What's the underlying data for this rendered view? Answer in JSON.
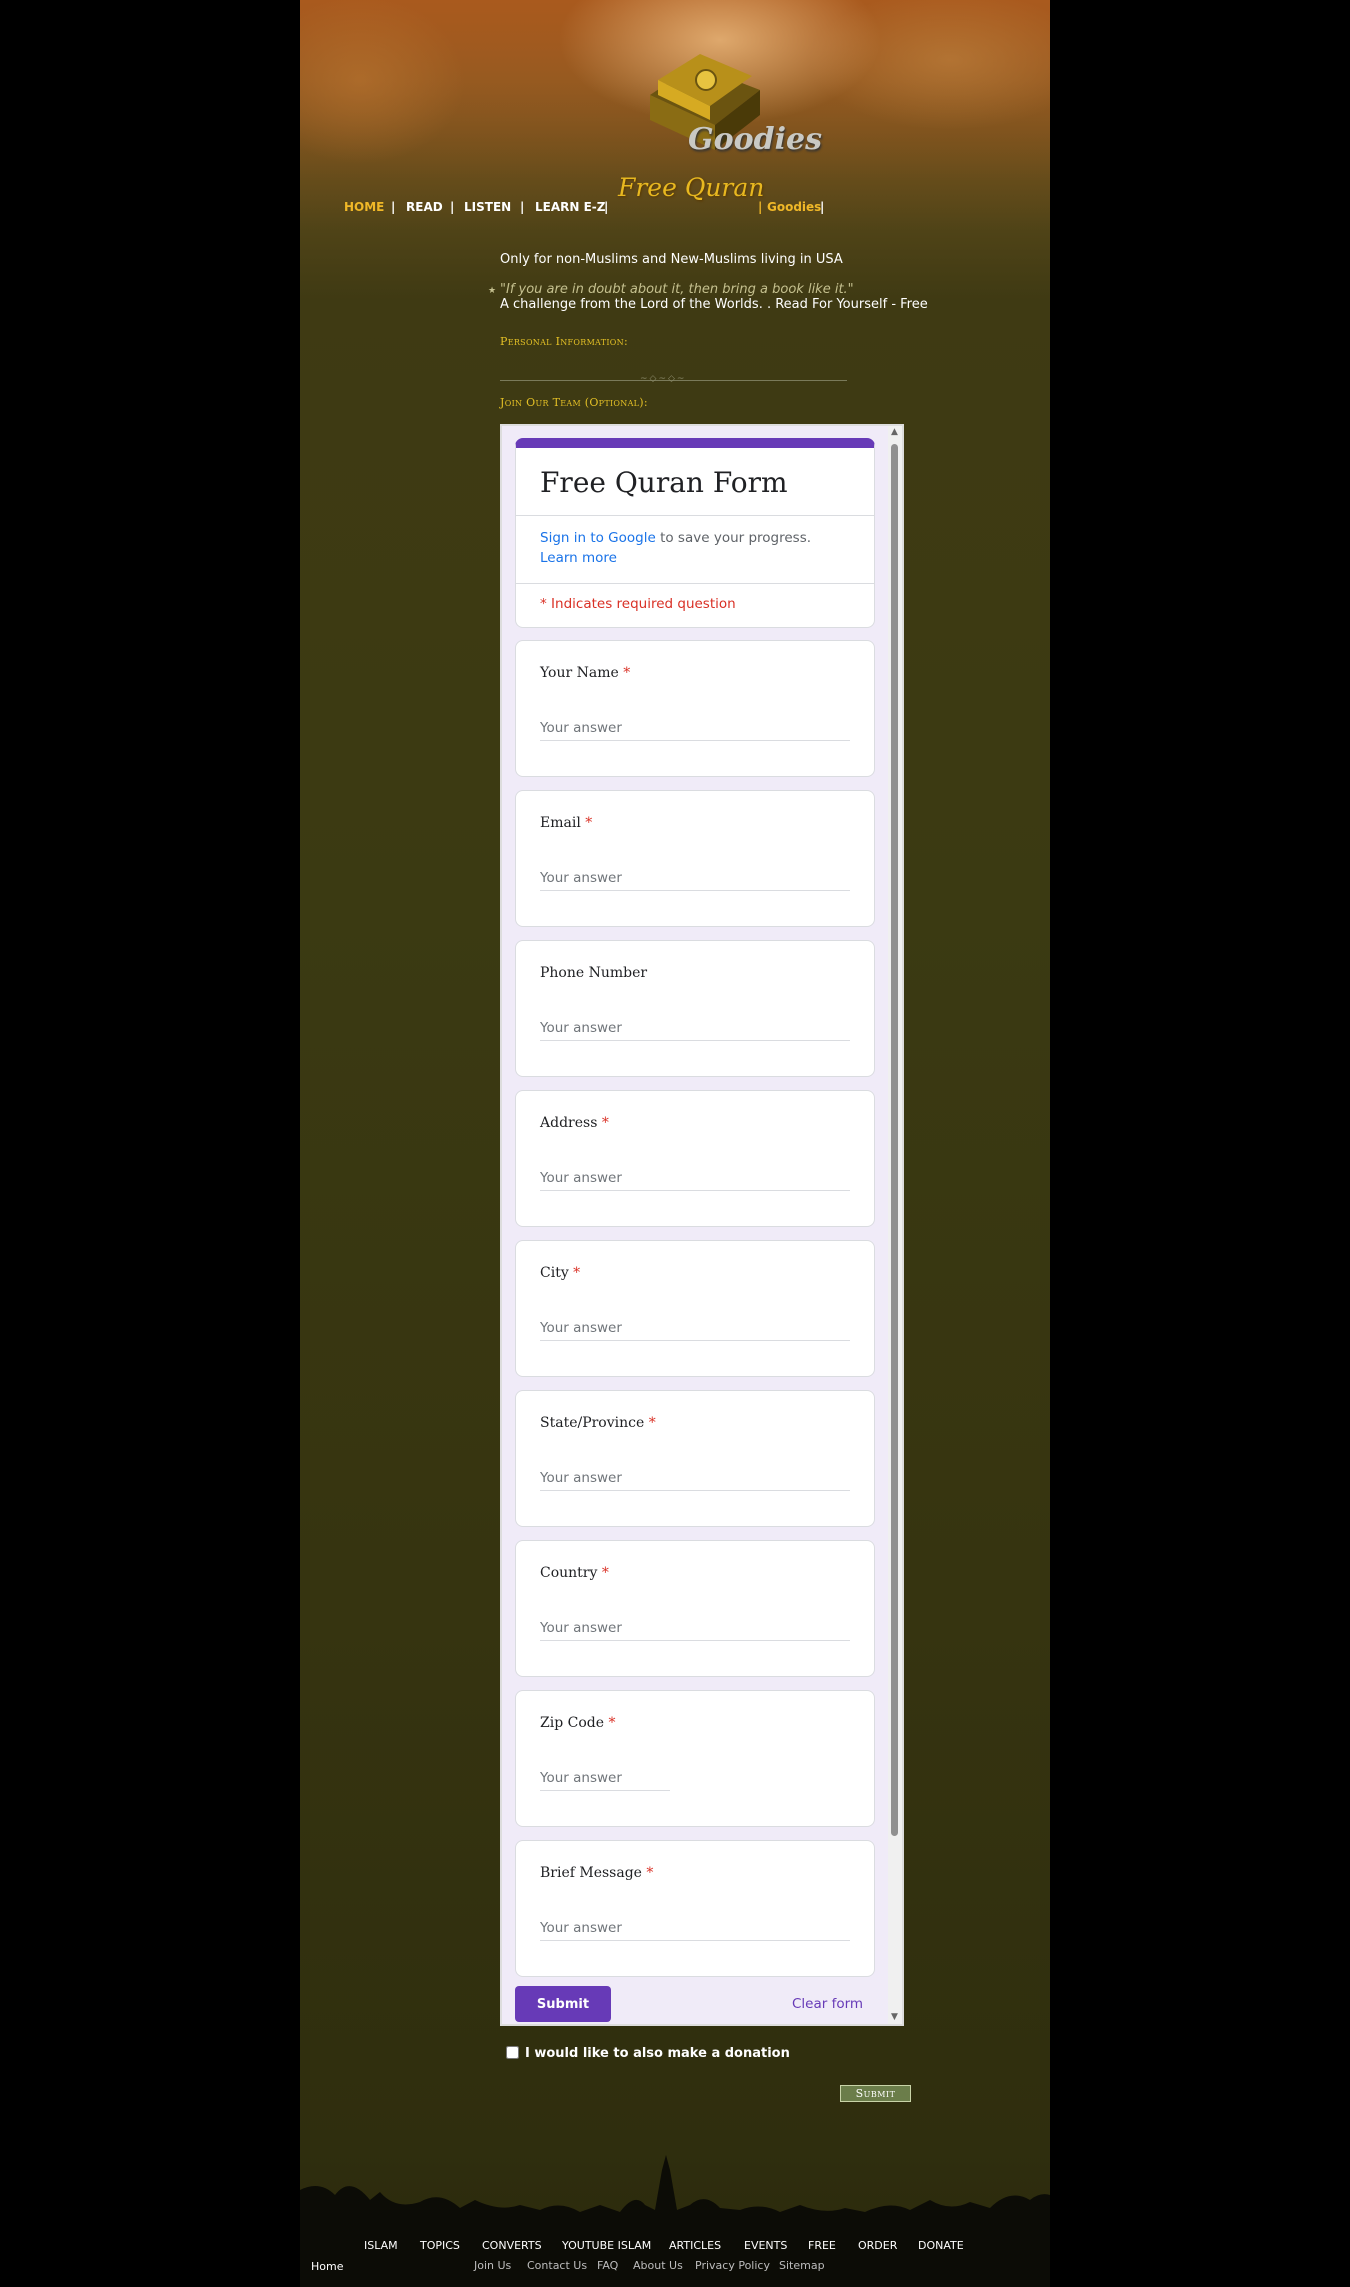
{
  "header": {
    "logo_goodies": "Goodies",
    "logo_free_quran": "Free Quran",
    "nav": [
      "HOME",
      "READ",
      "LISTEN",
      "LEARN E-Z",
      "Goodies"
    ],
    "separator": "|"
  },
  "intro": {
    "audience": "Only for non-Muslims and New-Muslims living in USA",
    "quote": "\"If you are in doubt about it, then bring a book like it.\"",
    "challenge": "A challenge from the Lord of the Worlds. . Read For Yourself - Free",
    "star": "★"
  },
  "sections": {
    "personal": "Personal Information:",
    "join": "Join Our Team (Optional):"
  },
  "form": {
    "title": "Free Quran Form",
    "signin_link": "Sign in to Google",
    "signin_rest": " to save your progress.",
    "learn_more": "Learn more",
    "required_note": "* Indicates required question",
    "placeholder": "Your answer",
    "questions": [
      {
        "label": "Your Name",
        "required": true
      },
      {
        "label": "Email",
        "required": true
      },
      {
        "label": "Phone Number",
        "required": false
      },
      {
        "label": "Address",
        "required": true
      },
      {
        "label": "City",
        "required": true
      },
      {
        "label": "State/Province",
        "required": true
      },
      {
        "label": "Country",
        "required": true
      },
      {
        "label": "Zip Code",
        "required": true
      },
      {
        "label": "Brief Message",
        "required": true
      }
    ],
    "submit_label": "Submit",
    "clear_label": "Clear form",
    "accent_color": "#673ab7",
    "required_color": "#d93025"
  },
  "donation": {
    "label": "I would like to also make a donation",
    "checked": false
  },
  "submit_old_label": "Submit",
  "footer": {
    "nav": [
      "ISLAM",
      "TOPICS",
      "CONVERTS",
      "YOUTUBE ISLAM",
      "ARTICLES",
      "EVENTS",
      "FREE",
      "ORDER",
      "DONATE"
    ],
    "home": "Home",
    "links": [
      "Join Us",
      "Contact Us",
      "FAQ",
      "About Us",
      "Privacy Policy",
      "Sitemap"
    ]
  },
  "icons": {
    "scroll_up": "scroll-up-arrow-icon",
    "scroll_down": "scroll-down-arrow-icon",
    "book": "quran-book-icon"
  }
}
